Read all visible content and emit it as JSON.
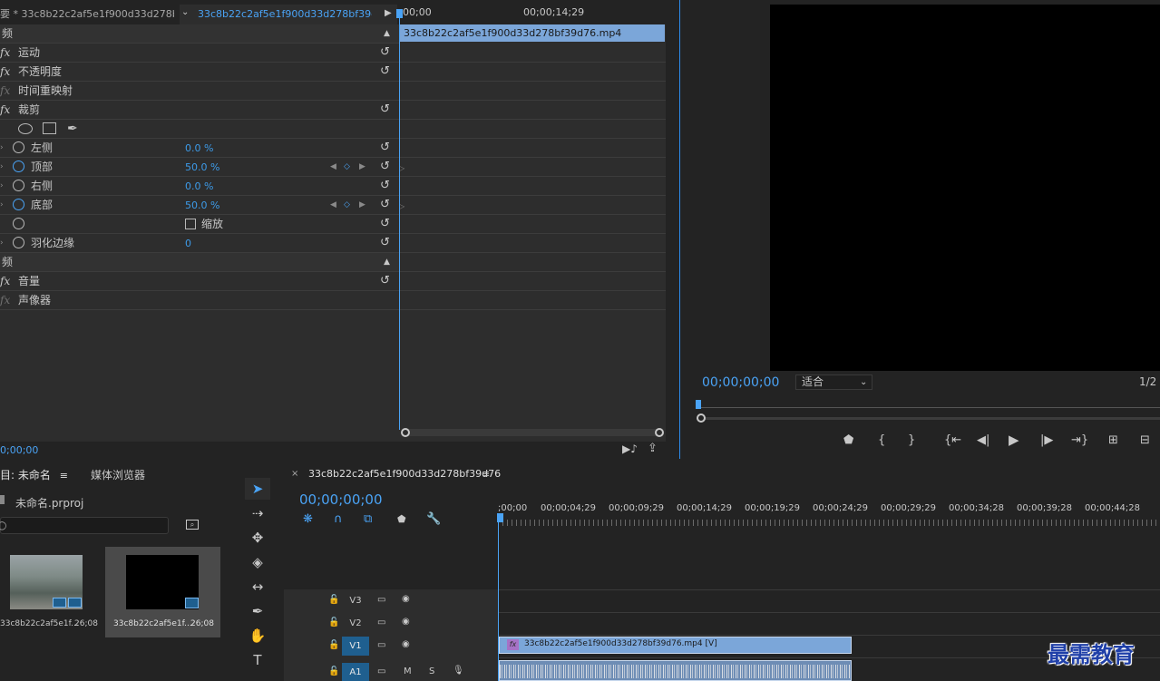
{
  "effect_controls": {
    "tab_source": "要 * 33c8b22c2af5e1f900d33d278bf3...",
    "tab_clip": "33c8b22c2af5e1f900d33d278bf39d76...",
    "tc_start": "00;00",
    "tc_mid": "00;00;14;29",
    "video_section": "频",
    "rows": {
      "motion": "运动",
      "opacity": "不透明度",
      "time_remap": "时间重映射",
      "crop": "裁剪",
      "left": "左侧",
      "left_val": "0.0 %",
      "top": "顶部",
      "top_val": "50.0 %",
      "right": "右侧",
      "right_val": "0.0 %",
      "bottom": "底部",
      "bottom_val": "50.0 %",
      "zoom": "缩放",
      "feather": "羽化边缘",
      "feather_val": "0"
    },
    "audio_section": "频",
    "volume": "音量",
    "panner": "声像器",
    "fx_label": "fx",
    "clip_name": "33c8b22c2af5e1f900d33d278bf39d76.mp4",
    "bottom_tc": "0;00;00"
  },
  "program": {
    "timecode": "00;00;00;00",
    "fit": "适合",
    "resolution": "1/2"
  },
  "project": {
    "tab_project": "目: 未命名",
    "tab_browser": "媒体浏览器",
    "project_file": "未命名.prproj",
    "items": [
      {
        "name": "33c8b22c2af5e1f...",
        "duration": "26;08"
      },
      {
        "name": "33c8b22c2af5e1f...",
        "duration": "26;08"
      }
    ]
  },
  "timeline": {
    "sequence_tab": "33c8b22c2af5e1f900d33d278bf39d76",
    "timecode": "00;00;00;00",
    "ruler": [
      ";00;00",
      "00;00;04;29",
      "00;00;09;29",
      "00;00;14;29",
      "00;00;19;29",
      "00;00;24;29",
      "00;00;29;29",
      "00;00;34;28",
      "00;00;39;28",
      "00;00;44;28"
    ],
    "tracks": [
      "V3",
      "V2",
      "V1",
      "A1"
    ],
    "track_m": "M",
    "track_s": "S",
    "video_clip": "33c8b22c2af5e1f900d33d278bf39d76.mp4 [V]",
    "video_clip_fx": "fx"
  },
  "watermark": "最需教育",
  "colors": {
    "accent": "#4aa3f5",
    "clip_blue": "#7ba6d9",
    "work_area": "#e6d200",
    "track_on": "#1f5f8f"
  }
}
